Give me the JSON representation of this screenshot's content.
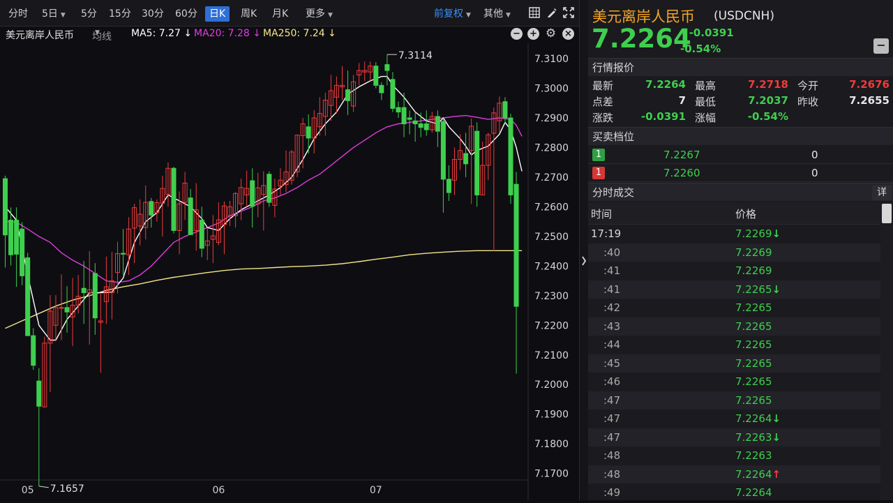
{
  "toolbar": {
    "periods": [
      "分时",
      "5日",
      "5分",
      "15分",
      "30分",
      "60分",
      "日K",
      "周K",
      "月K",
      "更多"
    ],
    "active_period": "日K",
    "adjust_label": "前复权",
    "other_label": "其他"
  },
  "ma_bar": {
    "symbol_name": "美元离岸人民币",
    "indicator_label": "均线",
    "ma5": "MA5: 7.27 ↓",
    "ma20": "MA20: 7.28 ↓",
    "ma250": "MA250: 7.24 ↓"
  },
  "colors": {
    "up": "#f03b3b",
    "down": "#3fcf4e",
    "ma5": "#ffffff",
    "ma20": "#e03ce0",
    "ma250": "#f5e68a",
    "active_tab": "#2f6fd6",
    "title_orange": "#f5a623"
  },
  "chart_data": {
    "type": "candlestick",
    "y_ticks": [
      "7.3100",
      "7.3000",
      "7.2900",
      "7.2800",
      "7.2700",
      "7.2600",
      "7.2500",
      "7.2400",
      "7.2300",
      "7.2200",
      "7.2100",
      "7.2000",
      "7.1900",
      "7.1800",
      "7.1700"
    ],
    "ylim": [
      7.1678,
      7.3152
    ],
    "x_labels": [
      {
        "label": "05",
        "index": 4
      },
      {
        "label": "06",
        "index": 38
      },
      {
        "label": "07",
        "index": 66
      }
    ],
    "annotations": [
      {
        "label": "7.3114",
        "index": 68,
        "value": 7.3114,
        "side": "top"
      },
      {
        "label": "7.1657",
        "index": 6,
        "value": 7.1657,
        "side": "bottom"
      }
    ],
    "candles": [
      [
        7.2695,
        7.2705,
        7.2395,
        7.2505
      ],
      [
        7.2555,
        7.2598,
        7.2402,
        7.2438
      ],
      [
        7.2555,
        7.2598,
        7.233,
        7.244
      ],
      [
        7.2525,
        7.2548,
        7.2335,
        7.2367
      ],
      [
        7.2428,
        7.2445,
        7.2168,
        7.2165
      ],
      [
        7.2165,
        7.219,
        7.205,
        7.2065
      ],
      [
        7.2012,
        7.2055,
        7.1657,
        7.1927
      ],
      [
        7.1925,
        7.2162,
        7.1922,
        7.214
      ],
      [
        7.214,
        7.2302,
        7.1975,
        7.2248
      ],
      [
        7.22,
        7.2302,
        7.215,
        7.226
      ],
      [
        7.226,
        7.2372,
        7.215,
        7.226
      ],
      [
        7.226,
        7.2332,
        7.2175,
        7.2245
      ],
      [
        7.2228,
        7.236,
        7.213,
        7.2268
      ],
      [
        7.2268,
        7.237,
        7.224,
        7.2298
      ],
      [
        7.2325,
        7.2417,
        7.2205,
        7.231
      ],
      [
        7.231,
        7.245,
        7.2135,
        7.232
      ],
      [
        7.2375,
        7.241,
        7.2168,
        7.2225
      ],
      [
        7.221,
        7.231,
        7.204,
        7.2215
      ],
      [
        7.228,
        7.2432,
        7.2205,
        7.233
      ],
      [
        7.231,
        7.2448,
        7.222,
        7.235
      ],
      [
        7.2378,
        7.2482,
        7.2308,
        7.2442
      ],
      [
        7.2443,
        7.2525,
        7.237,
        7.244
      ],
      [
        7.2438,
        7.2565,
        7.237,
        7.2525
      ],
      [
        7.2528,
        7.261,
        7.241,
        7.2597
      ],
      [
        7.2535,
        7.2625,
        7.247,
        7.2575
      ],
      [
        7.253,
        7.2672,
        7.249,
        7.2615
      ],
      [
        7.2618,
        7.263,
        7.253,
        7.2572
      ],
      [
        7.258,
        7.2625,
        7.255,
        7.2614
      ],
      [
        7.2612,
        7.2705,
        7.25,
        7.2662
      ],
      [
        7.2642,
        7.275,
        7.26,
        7.273
      ],
      [
        7.273,
        7.2735,
        7.251,
        7.252
      ],
      [
        7.252,
        7.2652,
        7.244,
        7.261
      ],
      [
        7.2615,
        7.2718,
        7.2556,
        7.268
      ],
      [
        7.263,
        7.266,
        7.251,
        7.2506
      ],
      [
        7.252,
        7.268,
        7.2452,
        7.259
      ],
      [
        7.2555,
        7.26,
        7.243,
        7.246
      ],
      [
        7.247,
        7.253,
        7.242,
        7.2485
      ],
      [
        7.249,
        7.2572,
        7.241,
        7.2502
      ],
      [
        7.248,
        7.2615,
        7.247,
        7.2556
      ],
      [
        7.254,
        7.2618,
        7.244,
        7.2603
      ],
      [
        7.257,
        7.262,
        7.2535,
        7.26
      ],
      [
        7.257,
        7.265,
        7.253,
        7.2645
      ],
      [
        7.261,
        7.2695,
        7.2555,
        7.2665
      ],
      [
        7.264,
        7.2722,
        7.26,
        7.2662
      ],
      [
        7.2688,
        7.273,
        7.253,
        7.2602
      ],
      [
        7.261,
        7.2715,
        7.2565,
        7.2664
      ],
      [
        7.2642,
        7.272,
        7.252,
        7.2672
      ],
      [
        7.271,
        7.272,
        7.26,
        7.2615
      ],
      [
        7.2605,
        7.2695,
        7.2565,
        7.266
      ],
      [
        7.267,
        7.273,
        7.264,
        7.269
      ],
      [
        7.2675,
        7.279,
        7.265,
        7.2718
      ],
      [
        7.269,
        7.2792,
        7.2675,
        7.2785
      ],
      [
        7.2718,
        7.2842,
        7.27,
        7.2842
      ],
      [
        7.284,
        7.29,
        7.273,
        7.288
      ],
      [
        7.287,
        7.2912,
        7.278,
        7.2832
      ],
      [
        7.2832,
        7.2926,
        7.278,
        7.29
      ],
      [
        7.287,
        7.297,
        7.284,
        7.2915
      ],
      [
        7.2905,
        7.2985,
        7.284,
        7.296
      ],
      [
        7.2942,
        7.3045,
        7.289,
        7.2992
      ],
      [
        7.297,
        7.304,
        7.2915,
        7.301
      ],
      [
        7.3005,
        7.3075,
        7.296,
        7.301
      ],
      [
        7.2995,
        7.306,
        7.291,
        7.2958
      ],
      [
        7.294,
        7.3045,
        7.292,
        7.3022
      ],
      [
        7.3045,
        7.3085,
        7.301,
        7.306
      ],
      [
        7.3055,
        7.309,
        7.3025,
        7.306
      ],
      [
        7.3055,
        7.309,
        7.3025,
        7.3075
      ],
      [
        7.3075,
        7.3088,
        7.3,
        7.301
      ],
      [
        7.301,
        7.302,
        7.296,
        7.2985
      ],
      [
        7.308,
        7.3114,
        7.301,
        7.306
      ],
      [
        7.303,
        7.3055,
        7.292,
        7.2932
      ],
      [
        7.2935,
        7.2955,
        7.29,
        7.292
      ],
      [
        7.2935,
        7.2985,
        7.2835,
        7.288
      ],
      [
        7.29,
        7.2925,
        7.2845,
        7.2895
      ],
      [
        7.289,
        7.292,
        7.282,
        7.288
      ],
      [
        7.288,
        7.2918,
        7.2835,
        7.2868
      ],
      [
        7.288,
        7.2925,
        7.284,
        7.286
      ],
      [
        7.286,
        7.292,
        7.285,
        7.2905
      ],
      [
        7.2905,
        7.2925,
        7.2802,
        7.2855
      ],
      [
        7.2888,
        7.29,
        7.258,
        7.2693
      ],
      [
        7.2693,
        7.274,
        7.262,
        7.2648
      ],
      [
        7.269,
        7.28,
        7.264,
        7.276
      ],
      [
        7.276,
        7.2845,
        7.2725,
        7.279
      ],
      [
        7.278,
        7.285,
        7.27,
        7.2745
      ],
      [
        7.279,
        7.2898,
        7.261,
        7.2872
      ],
      [
        7.2855,
        7.2885,
        7.26,
        7.264
      ],
      [
        7.264,
        7.282,
        7.264,
        7.274
      ],
      [
        7.274,
        7.285,
        7.269,
        7.2843
      ],
      [
        7.2848,
        7.2935,
        7.245,
        7.2917
      ],
      [
        7.289,
        7.2972,
        7.285,
        7.295
      ],
      [
        7.2955,
        7.297,
        7.288,
        7.29
      ],
      [
        7.29,
        7.2914,
        7.261,
        7.264
      ],
      [
        7.2676,
        7.2718,
        7.2037,
        7.2264
      ]
    ],
    "ma5": [
      [
        0,
        7.26
      ],
      [
        2,
        7.2555
      ],
      [
        4,
        7.237
      ],
      [
        6,
        7.22
      ],
      [
        8,
        7.215
      ],
      [
        9,
        7.215
      ],
      [
        11,
        7.222
      ],
      [
        13,
        7.2265
      ],
      [
        15,
        7.231
      ],
      [
        17,
        7.231
      ],
      [
        19,
        7.2312
      ],
      [
        21,
        7.236
      ],
      [
        23,
        7.248
      ],
      [
        25,
        7.255
      ],
      [
        27,
        7.258
      ],
      [
        29,
        7.264
      ],
      [
        31,
        7.262
      ],
      [
        33,
        7.26
      ],
      [
        35,
        7.256
      ],
      [
        36,
        7.253
      ],
      [
        38,
        7.252
      ],
      [
        40,
        7.256
      ],
      [
        42,
        7.259
      ],
      [
        43,
        7.26
      ],
      [
        45,
        7.262
      ],
      [
        47,
        7.264
      ],
      [
        49,
        7.2665
      ],
      [
        51,
        7.27
      ],
      [
        53,
        7.276
      ],
      [
        55,
        7.283
      ],
      [
        57,
        7.288
      ],
      [
        59,
        7.292
      ],
      [
        61,
        7.298
      ],
      [
        63,
        7.3005
      ],
      [
        65,
        7.3025
      ],
      [
        67,
        7.304
      ],
      [
        68,
        7.304
      ],
      [
        69,
        7.301
      ],
      [
        71,
        7.297
      ],
      [
        73,
        7.292
      ],
      [
        75,
        7.289
      ],
      [
        77,
        7.288
      ],
      [
        78,
        7.29
      ],
      [
        79,
        7.287
      ],
      [
        81,
        7.283
      ],
      [
        82,
        7.2805
      ],
      [
        83,
        7.2775
      ],
      [
        84,
        7.279
      ],
      [
        86,
        7.2805
      ],
      [
        88,
        7.2845
      ],
      [
        89,
        7.2885
      ],
      [
        90,
        7.286
      ],
      [
        91,
        7.28
      ],
      [
        92,
        7.272
      ]
    ],
    "ma20": [
      [
        0,
        7.255
      ],
      [
        2,
        7.2548
      ],
      [
        4,
        7.2525
      ],
      [
        6,
        7.25
      ],
      [
        8,
        7.248
      ],
      [
        10,
        7.2445
      ],
      [
        12,
        7.242
      ],
      [
        14,
        7.24
      ],
      [
        16,
        7.2375
      ],
      [
        18,
        7.235
      ],
      [
        20,
        7.2345
      ],
      [
        22,
        7.235
      ],
      [
        24,
        7.237
      ],
      [
        26,
        7.24
      ],
      [
        28,
        7.244
      ],
      [
        30,
        7.248
      ],
      [
        32,
        7.25
      ],
      [
        34,
        7.2515
      ],
      [
        36,
        7.253
      ],
      [
        38,
        7.2545
      ],
      [
        40,
        7.257
      ],
      [
        42,
        7.2585
      ],
      [
        44,
        7.26
      ],
      [
        46,
        7.262
      ],
      [
        48,
        7.263
      ],
      [
        50,
        7.2645
      ],
      [
        52,
        7.2665
      ],
      [
        54,
        7.269
      ],
      [
        56,
        7.271
      ],
      [
        58,
        7.274
      ],
      [
        60,
        7.277
      ],
      [
        62,
        7.28
      ],
      [
        64,
        7.2825
      ],
      [
        66,
        7.285
      ],
      [
        68,
        7.287
      ],
      [
        70,
        7.288
      ],
      [
        72,
        7.2885
      ],
      [
        74,
        7.289
      ],
      [
        76,
        7.2895
      ],
      [
        78,
        7.29
      ],
      [
        80,
        7.2905
      ],
      [
        82,
        7.2908
      ],
      [
        84,
        7.2902
      ],
      [
        86,
        7.2895
      ],
      [
        88,
        7.29
      ],
      [
        90,
        7.2895
      ],
      [
        91,
        7.2875
      ],
      [
        92,
        7.2838
      ]
    ],
    "ma250": [
      [
        0,
        7.219
      ],
      [
        3,
        7.2215
      ],
      [
        6,
        7.224
      ],
      [
        9,
        7.2265
      ],
      [
        12,
        7.2285
      ],
      [
        15,
        7.23
      ],
      [
        18,
        7.2318
      ],
      [
        21,
        7.233
      ],
      [
        24,
        7.234
      ],
      [
        27,
        7.2352
      ],
      [
        30,
        7.2362
      ],
      [
        33,
        7.237
      ],
      [
        36,
        7.2378
      ],
      [
        39,
        7.2385
      ],
      [
        42,
        7.239
      ],
      [
        45,
        7.2392
      ],
      [
        48,
        7.2395
      ],
      [
        51,
        7.2398
      ],
      [
        54,
        7.24
      ],
      [
        57,
        7.2403
      ],
      [
        60,
        7.2408
      ],
      [
        63,
        7.2415
      ],
      [
        66,
        7.2423
      ],
      [
        69,
        7.243
      ],
      [
        72,
        7.2438
      ],
      [
        75,
        7.2443
      ],
      [
        78,
        7.2447
      ],
      [
        81,
        7.245
      ],
      [
        84,
        7.2452
      ],
      [
        87,
        7.2452
      ],
      [
        90,
        7.2452
      ],
      [
        92,
        7.2452
      ]
    ]
  },
  "quote": {
    "name": "美元离岸人民币",
    "code": "(USDCNH)",
    "price": "7.2264",
    "change": "-0.0391",
    "change_pct": "-0.54%"
  },
  "market": {
    "title": "行情报价",
    "latest_label": "最新",
    "latest": "7.2264",
    "high_label": "最高",
    "high": "7.2718",
    "open_label": "今开",
    "open": "7.2676",
    "pts_label": "点差",
    "pts": "7",
    "low_label": "最低",
    "low": "7.2037",
    "prev_label": "昨收",
    "prev": "7.2655",
    "chg_label": "涨跌",
    "chg": "-0.0391",
    "pct_label": "涨幅",
    "pct": "-0.54%"
  },
  "orderbook": {
    "title": "买卖档位",
    "rows": [
      {
        "badge": "1",
        "price": "7.2267",
        "qty": "0"
      },
      {
        "badge": "1",
        "price": "7.2260",
        "qty": "0"
      }
    ]
  },
  "trades": {
    "title": "分时成交",
    "detail_label": "详",
    "col_time": "时间",
    "col_price": "价格",
    "rows": [
      {
        "time": "17:19",
        "price": "7.2269↓"
      },
      {
        "time": ":40",
        "price": "7.2269"
      },
      {
        "time": ":41",
        "price": "7.2269"
      },
      {
        "time": ":41",
        "price": "7.2265↓"
      },
      {
        "time": ":42",
        "price": "7.2265"
      },
      {
        "time": ":43",
        "price": "7.2265"
      },
      {
        "time": ":44",
        "price": "7.2265"
      },
      {
        "time": ":45",
        "price": "7.2265"
      },
      {
        "time": ":46",
        "price": "7.2265"
      },
      {
        "time": ":47",
        "price": "7.2265"
      },
      {
        "time": ":47",
        "price": "7.2264↓"
      },
      {
        "time": ":47",
        "price": "7.2263↓"
      },
      {
        "time": ":48",
        "price": "7.2263"
      },
      {
        "time": ":48",
        "price": "7.2264↑"
      },
      {
        "time": ":49",
        "price": "7.2264"
      }
    ]
  }
}
